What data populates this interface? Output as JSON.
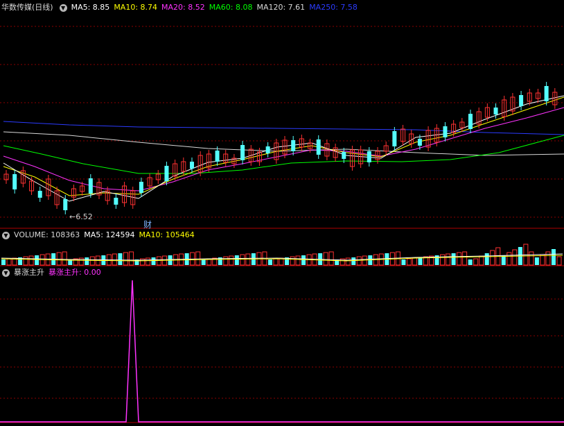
{
  "price_panel": {
    "stock_title": "华数传媒(日线)",
    "ma": [
      {
        "label": "MA5: 8.85",
        "color": "#ffffff"
      },
      {
        "label": "MA10: 8.74",
        "color": "#ffff00"
      },
      {
        "label": "MA20: 8.52",
        "color": "#ff33ff"
      },
      {
        "label": "MA60: 8.08",
        "color": "#00ff00"
      },
      {
        "label": "MA120: 7.61",
        "color": "#d8d8d8"
      },
      {
        "label": "MA250: 7.58",
        "color": "#2b3bff"
      }
    ],
    "low_marker": "6.52",
    "event_marker": "财"
  },
  "volume_panel": {
    "title": "VOLUME: 108363",
    "ma5": "MA5: 124594",
    "ma10": "MA10: 105464"
  },
  "indicator_panel": {
    "title": "暴涨主升",
    "value_label": "暴涨主升: 0.00"
  },
  "colors": {
    "up": "#ff3232",
    "down": "#54ffff",
    "grid": "#8b0000",
    "background": "#000000"
  }
}
